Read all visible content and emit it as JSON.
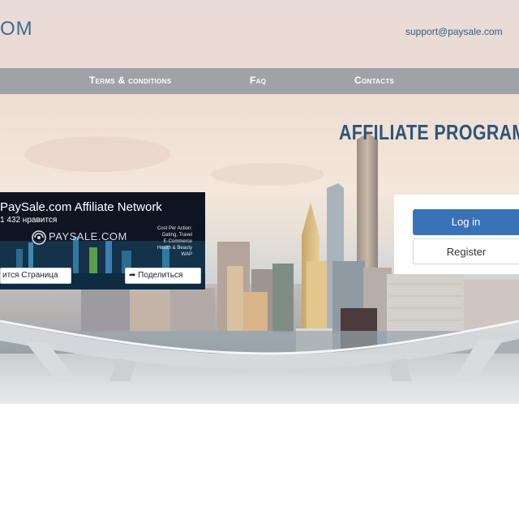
{
  "header": {
    "logo_text": "OM",
    "support_email": "support@paysale.com"
  },
  "nav": {
    "items": [
      {
        "label": "Terms & conditions"
      },
      {
        "label": "Faq"
      },
      {
        "label": "Contacts"
      }
    ]
  },
  "hero": {
    "title": "AFFILIATE PROGRAM"
  },
  "facebook_widget": {
    "page_name": "PaySale.com Affiliate Network",
    "likes": "1 432 нравится",
    "brand": "PAYSALE.COM",
    "tagline": [
      "Cost Per Action:",
      "Dating, Travel",
      "E-Commerce",
      "Health & Beauty",
      "WAP"
    ],
    "follow_button": "ится Страница",
    "share_button": "Поделиться",
    "icons": [
      "paysale-logo-icon",
      "share-icon"
    ]
  },
  "auth": {
    "login_label": "Log in",
    "register_label": "Register"
  },
  "colors": {
    "brand_blue": "#3a72b6",
    "title_blue": "#2d5579",
    "nav_bg": "#8c969c"
  }
}
